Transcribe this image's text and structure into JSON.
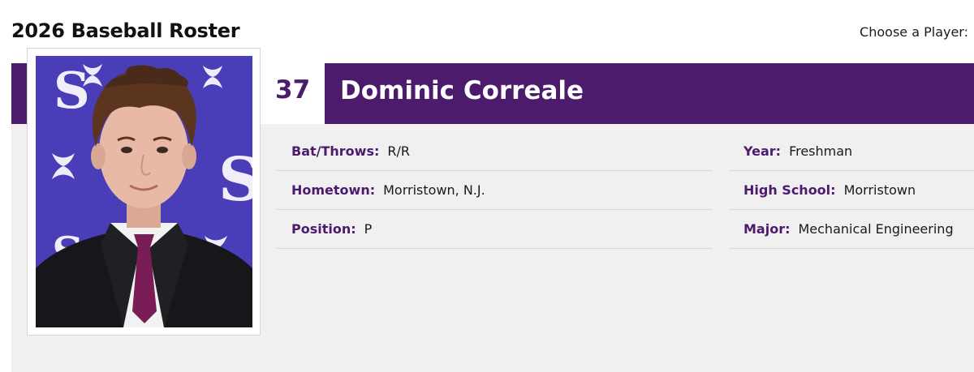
{
  "page": {
    "title": "2026 Baseball Roster",
    "player_chooser_label": "Choose a Player:"
  },
  "player": {
    "number": "37",
    "name": "Dominic Correale",
    "details_left": [
      {
        "label": "Bat/Throws:",
        "value": "R/R"
      },
      {
        "label": "Hometown:",
        "value": "Morristown, N.J."
      },
      {
        "label": "Position:",
        "value": "P"
      }
    ],
    "details_right": [
      {
        "label": "Year:",
        "value": "Freshman"
      },
      {
        "label": "High School:",
        "value": "Morristown"
      },
      {
        "label": "Major:",
        "value": "Mechanical Engineering"
      }
    ]
  },
  "colors": {
    "brand_purple": "#4c1b6c",
    "photo_backdrop": "#4a3db8",
    "card_background": "#f0f0f0"
  }
}
